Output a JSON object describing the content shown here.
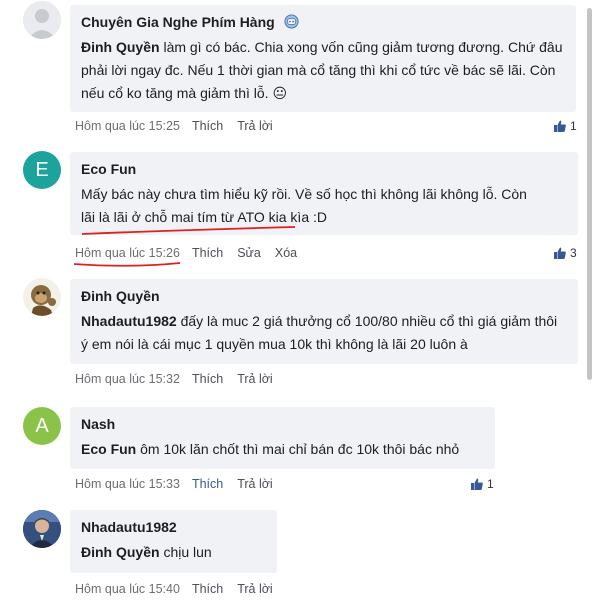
{
  "comments": [
    {
      "author": "Chuyên Gia Nghe Phím Hàng",
      "mention": "Đinh Quyền",
      "text": " làm gì có bác. Chia xong vốn cũng giảm tương đương. Chứ đâu phải lời ngay đc. Nếu 1 thời gian mà cổ tăng thì khi cổ tức về bác sẽ lãi. Còn nếu cổ ko tăng mà giảm thì lỗ. ",
      "emoji": "😐",
      "time": "Hôm qua lúc 15:25",
      "actions": [
        "Thích",
        "Trả lời"
      ],
      "likes": "1"
    },
    {
      "author": "Eco Fun",
      "avatar_letter": "E",
      "avatar_color": "#1ba39c",
      "text_line1": "Mấy bác này chưa tìm hiểu kỹ rồi. Về số học thì không lãi không lỗ. Còn",
      "text_line2": "lãi là lãi ở chỗ mai tím từ ATO kia kìa :D",
      "time": "Hôm qua lúc 15:26",
      "actions": [
        "Thích",
        "Sửa",
        "Xóa"
      ],
      "likes": "3"
    },
    {
      "author": "Đinh Quyền",
      "mention": "Nhadautu1982",
      "text": " đấy là muc 2 giá thưởng cổ 100/80 nhiều cổ thì giá giảm thôi ý em nói là cái mục 1 quyền mua 10k thì không là lãi 20 luôn à",
      "time": "Hôm qua lúc 15:32",
      "actions": [
        "Thích",
        "Trả lời"
      ]
    },
    {
      "author": "Nash",
      "avatar_letter": "A",
      "avatar_color": "#8bc34a",
      "mention": "Eco Fun",
      "text": " ôm 10k lăn chốt thì mai chỉ bán đc 10k thôi bác nhỏ",
      "time": "Hôm qua lúc 15:33",
      "actions": [
        "Thích",
        "Trả lời"
      ],
      "likes": "1"
    },
    {
      "author": "Nhadautu1982",
      "mention": "Đinh Quyền",
      "text": " chịu lun",
      "time": "Hôm qua lúc 15:40",
      "actions": [
        "Thích",
        "Trả lời"
      ]
    }
  ],
  "colors": {
    "bubble": "#f0f2f5",
    "like_blue": "#385898",
    "annotation_red": "#e02020"
  }
}
